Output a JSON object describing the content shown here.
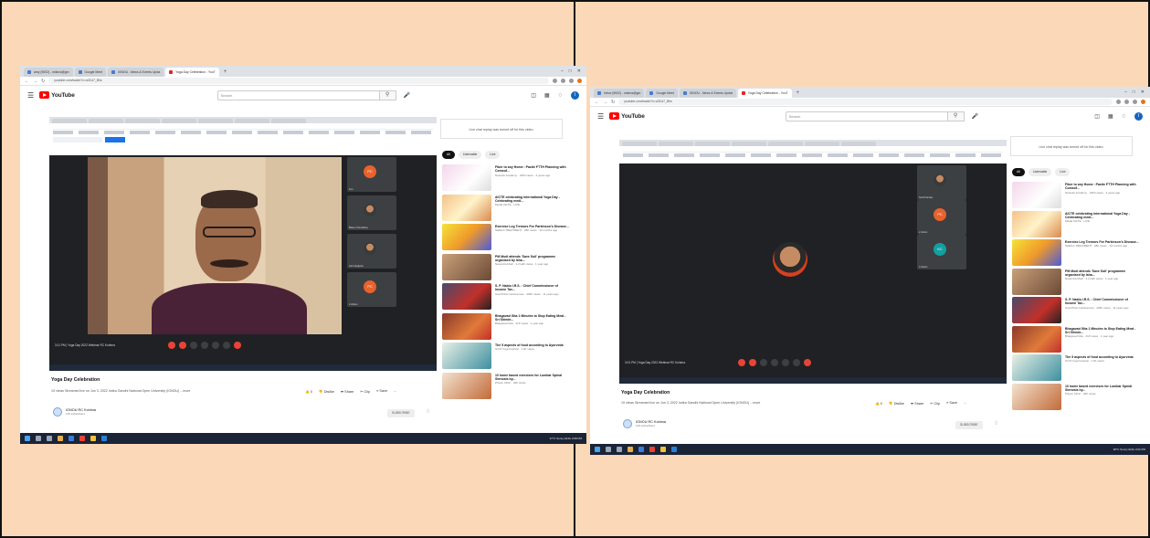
{
  "screens": [
    {
      "tabs": [
        "amy (9002) - mishra@gm",
        "Google Meet",
        "IGNOU - News & Events Upda",
        "Yoga Day Celebration - YouT"
      ],
      "url": "youtube.com/watch?v=a3Cd7_Bhs",
      "youtube_logo": "YouTube",
      "search_placeholder": "Search",
      "live_chat_notice": "Live chat replay was turned off for this video.",
      "chips": [
        "All",
        "Listenable",
        "Live"
      ],
      "participants": [
        "Fou",
        "Bhanu Choudhary",
        "Anil Jangleria",
        "2 others"
      ],
      "meet_bar_title": "3:11 PM | Yoga Day 2022 Webinar RC Kohima",
      "video_title": "Yoga Day Celebration",
      "video_meta": "19 views  Streamed live on Jun 3, 2022  Indira Gandhi National Open University (IGNOU) ...more",
      "actions": {
        "likes": "0",
        "dislike": "Dislike",
        "share": "Share",
        "clip": "Clip",
        "save": "Save",
        "more": "..."
      },
      "channel_name": "IGNOU RC Kohima",
      "channel_subs": "116 subscribers",
      "subscribe": "SUBSCRIBE",
      "recs": [
        {
          "title": "Fiber to any Home : Pasitv FTTH Planning with Comsof...",
          "meta": "Network Academy · 2304 views · 4 years ago"
        },
        {
          "title": "AICTE celebrating International Yoga Day - Celebrating medi...",
          "meta": "Media AICTE · LIVE"
        },
        {
          "title": "Exercise Leg Tremors For Parkinson's Disease...",
          "meta": "SHEILA TREATMENT · 28K views · 10 months ago"
        },
        {
          "title": "PM Modi attends 'Save Soil' programme organised by Isha...",
          "meta": "Narendra Modi · 4.2 lakh views · 1 year ago"
        },
        {
          "title": "S. P. Naidu I.R.S. : Chief Commissioner of Income Tax...",
          "meta": "CareThink Conferences · 206K views · 11 years ago"
        },
        {
          "title": "Bhagavad Gita 1 Minutes to Stop Eating Meat - Sri Shinde...",
          "meta": "Bhagavad Gita · 41K views · 1 year ago"
        },
        {
          "title": "The 5 aspects of food according to Ayurveda",
          "meta": "Sri M Yoga Festival · 1.4K views"
        },
        {
          "title": "10 home based exercises for Lumbar Spinal Stenosis by...",
          "meta": "Physio Clinic · 32K views"
        }
      ],
      "tray": "37°C  Sunny  ENG  3:08 PM"
    },
    {
      "tabs": [
        "Inbox (9002) - mishra@gm",
        "Google Meet",
        "IGNOU - News & Events Updat",
        "Yoga Day Celebration - YouT"
      ],
      "url": "youtube.com/watch?v=a3Cd7_Bhs",
      "youtube_logo": "YouTube",
      "search_placeholder": "Search",
      "live_chat_notice": "Live chat replay was turned off for this video.",
      "chips": [
        "All",
        "Listenable",
        "Live"
      ],
      "participants": [
        "Sunil Pandey",
        "2 others",
        "4 others"
      ],
      "meet_bar_title": "3:01 PM | Yoga Day 2022 Webinar RC Kohima",
      "video_title": "Yoga Day Celebration",
      "video_meta": "19 views  Streamed live on Jun 3, 2022  Indira Gandhi National Open University (IGNOU) ...more",
      "actions": {
        "likes": "0",
        "dislike": "Dislike",
        "share": "Share",
        "clip": "Clip",
        "save": "Save",
        "more": "..."
      },
      "channel_name": "IGNOU RC Kohima",
      "channel_subs": "116 subscribers",
      "subscribe": "SUBSCRIBE",
      "recs": [
        {
          "title": "Fiber to any Home : Pasitv FTTH Planning with Comsof...",
          "meta": "Network Academy · 2304 views · 4 years ago"
        },
        {
          "title": "AICTE celebrating International Yoga Day - Celebrating medi...",
          "meta": "Media AICTE · LIVE"
        },
        {
          "title": "Exercise Leg Tremors For Parkinson's Disease...",
          "meta": "SHEILA TREATMENT · 28K views · 10 months ago"
        },
        {
          "title": "PM Modi attends 'Save Soil' programme organised by Isha...",
          "meta": "Narendra Modi · 4.2 lakh views · 1 year ago"
        },
        {
          "title": "S. P. Naidu I.R.S. : Chief Commissioner of Income Tax...",
          "meta": "CareThink Conferences · 206K views · 11 years ago"
        },
        {
          "title": "Bhagavad Gita 1 Minutes to Stop Eating Meat - Sri Shinde...",
          "meta": "Bhagavad Gita · 41K views · 1 year ago"
        },
        {
          "title": "The 5 aspects of food according to Ayurveda",
          "meta": "Sri M Yoga Festival · 1.4K views"
        },
        {
          "title": "10 home based exercises for Lumbar Spinal Stenosis by...",
          "meta": "Physio Clinic · 32K views"
        }
      ],
      "tray": "38°C  Sunny  ENG  3:02 PM"
    }
  ],
  "colors": {
    "background": "#fbd8b8",
    "youtube_red": "#ff0000",
    "meet_dark": "#202124"
  }
}
